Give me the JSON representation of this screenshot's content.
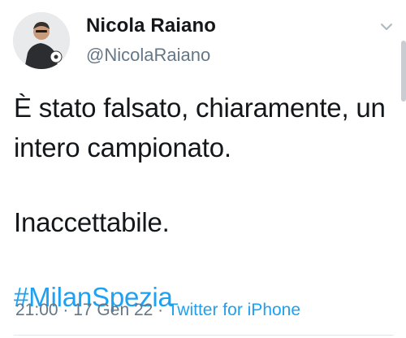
{
  "author": {
    "display_name": "Nicola Raiano",
    "handle": "@NicolaRaiano",
    "avatar_icon": "person-avatar"
  },
  "tweet": {
    "line_1": "È stato falsato, chiaramente, un intero campionato.",
    "line_2": "Inaccettabile.",
    "hashtag": "#MilanSpezia"
  },
  "meta": {
    "time": "21:00",
    "separator": " · ",
    "date": "17 Gen 22",
    "source": "Twitter for iPhone"
  },
  "colors": {
    "link": "#1da1f2",
    "text": "#14171a",
    "secondary": "#657786"
  },
  "icons": {
    "menu": "chevron-down-icon"
  }
}
